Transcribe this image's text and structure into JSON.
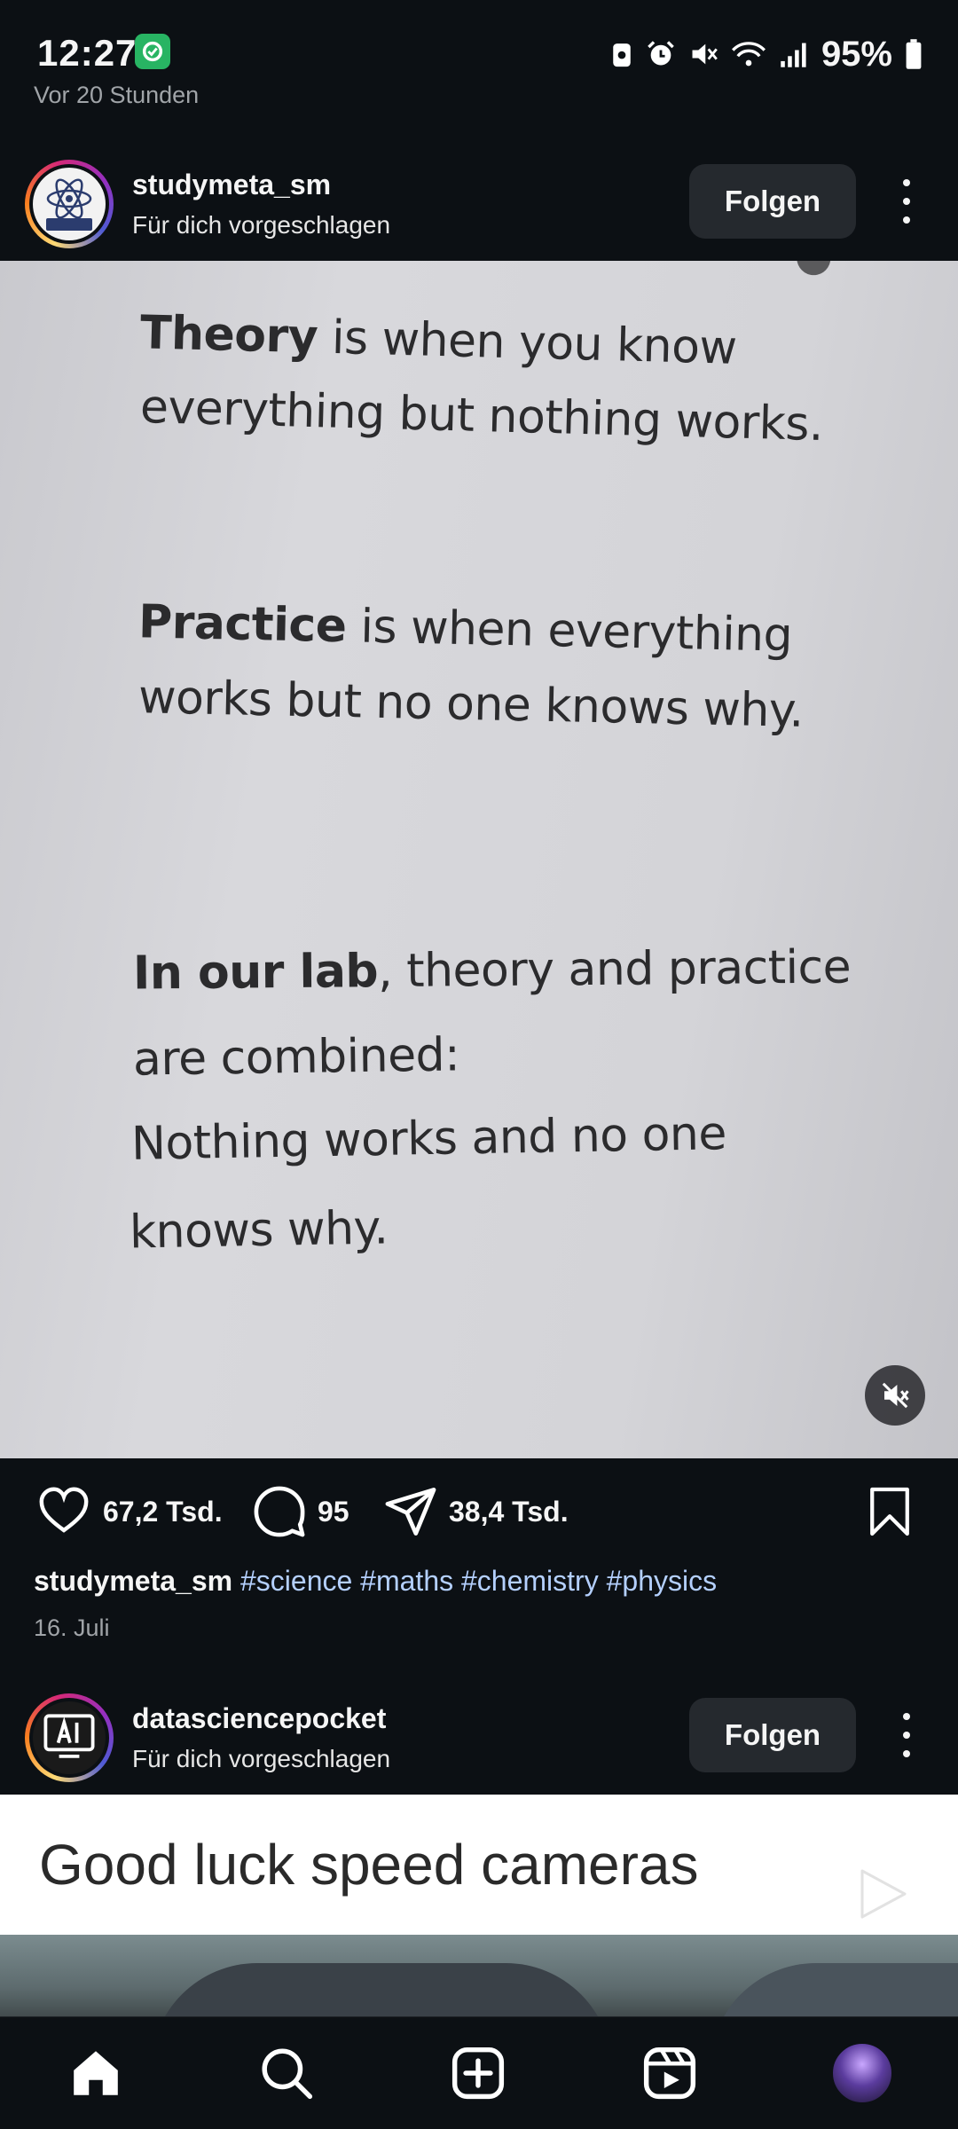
{
  "status_bar": {
    "time": "12:27",
    "ago": "Vor 20 Stunden",
    "battery": "95%",
    "icons": [
      "lock-recorder-icon",
      "alarm-icon",
      "mute-icon",
      "wifi-icon",
      "signal-icon",
      "battery-icon"
    ]
  },
  "post1": {
    "username": "studymeta_sm",
    "suggested": "Für dich vorgeschlagen",
    "follow_label": "Folgen",
    "image_text": {
      "l1_bold": "Theory",
      "l1_rest": " is when you know",
      "l2": "everything but nothing works.",
      "l3_bold": "Practice",
      "l3_rest": " is when everything",
      "l4": "works but no one knows why.",
      "l5_bold": "In our lab",
      "l5_rest": ", theory and  practice",
      "l6": "are combined:",
      "l7": "Nothing works and no one",
      "l8": "knows why."
    },
    "likes": "67,2 Tsd.",
    "comments": "95",
    "shares": "38,4 Tsd.",
    "caption_user": "studymeta_sm",
    "hashtags": [
      "#science",
      "#maths",
      "#chemistry",
      "#physics"
    ],
    "date": "16. Juli"
  },
  "post2": {
    "username": "datasciencepocket",
    "suggested": "Für dich vorgeschlagen",
    "follow_label": "Folgen",
    "image_title": "Good luck speed cameras"
  },
  "nav": {
    "items": [
      "home-icon",
      "search-icon",
      "create-icon",
      "reels-icon",
      "profile-avatar"
    ]
  },
  "colors": {
    "background": "#0c1014",
    "button": "#25292e",
    "hashtag": "#b4d0ff"
  }
}
